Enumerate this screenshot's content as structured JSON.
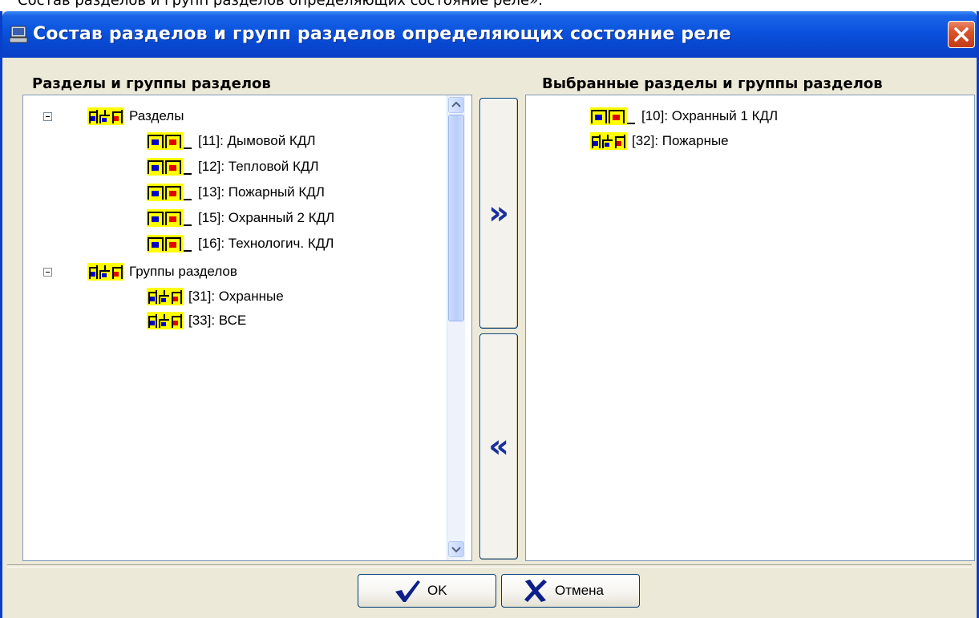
{
  "caption": "Состав разделов и групп разделов определяющих состояние реле».",
  "window": {
    "title": "Состав разделов и групп разделов определяющих состояние реле"
  },
  "left": {
    "header": "Разделы и группы разделов",
    "tree": [
      {
        "label": "Разделы",
        "icon": "partition-group-icon",
        "children": [
          {
            "label": "[11]: Дымовой КДЛ",
            "icon": "partition-icon"
          },
          {
            "label": "[12]: Тепловой КДЛ",
            "icon": "partition-icon"
          },
          {
            "label": "[13]: Пожарный КДЛ",
            "icon": "partition-icon"
          },
          {
            "label": "[15]: Охранный 2 КДЛ",
            "icon": "partition-icon"
          },
          {
            "label": "[16]: Технологич. КДЛ",
            "icon": "partition-icon"
          }
        ]
      },
      {
        "label": "Группы разделов",
        "icon": "partition-group-icon",
        "children": [
          {
            "label": "[31]: Охранные",
            "icon": "partition-group-icon"
          },
          {
            "label": "[33]: ВСЕ",
            "icon": "partition-group-icon"
          }
        ]
      }
    ]
  },
  "right": {
    "header": "Выбранные разделы и группы разделов",
    "items": [
      {
        "label": "[10]: Охранный 1 КДЛ",
        "icon": "partition-icon"
      },
      {
        "label": "[32]: Пожарные",
        "icon": "partition-group-icon"
      }
    ]
  },
  "move_buttons": {
    "add": "»",
    "remove": "«"
  },
  "buttons": {
    "ok": "OK",
    "cancel": "Отмена"
  },
  "colors": {
    "titlebar": "#0a52dd",
    "icon_yellow": "#ffff00",
    "icon_blue": "#0000c8",
    "icon_red": "#e00000",
    "arrow": "#1a2f9e"
  }
}
